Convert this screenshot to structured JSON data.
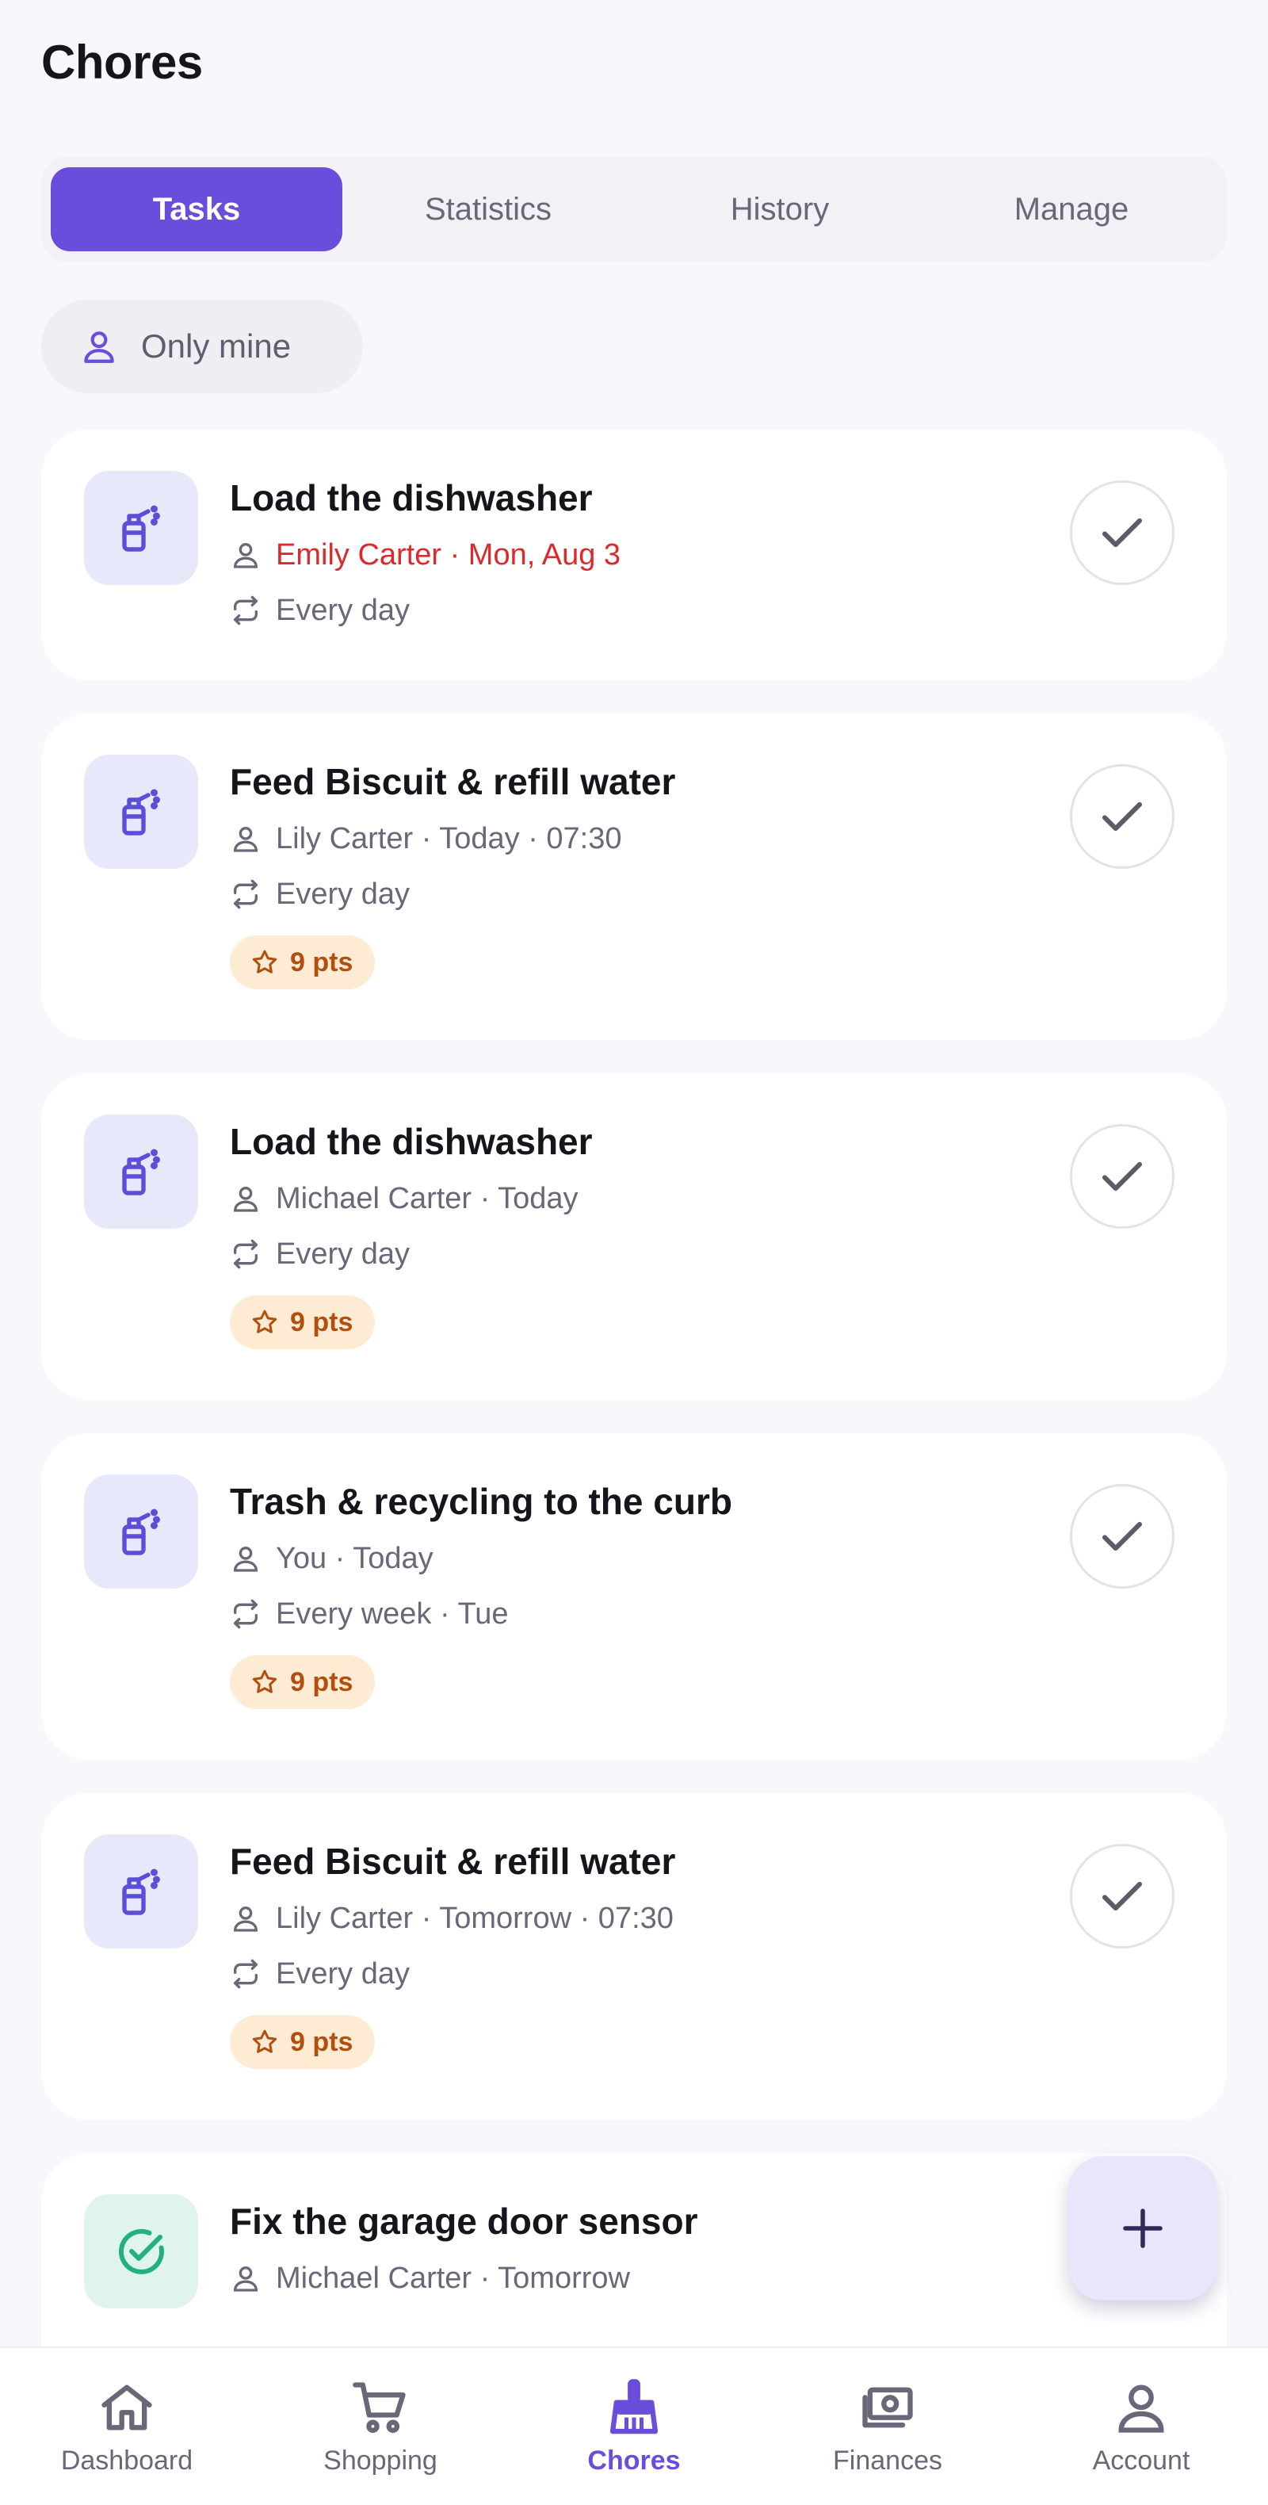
{
  "header": {
    "title": "Chores"
  },
  "tabs": [
    {
      "label": "Tasks",
      "active": true
    },
    {
      "label": "Statistics",
      "active": false
    },
    {
      "label": "History",
      "active": false
    },
    {
      "label": "Manage",
      "active": false
    }
  ],
  "filter": {
    "label": "Only mine",
    "icon": "person-icon"
  },
  "tasks": [
    {
      "title": "Load the dishwasher",
      "assignee_line": "Emily Carter · Mon, Aug 3",
      "overdue": true,
      "recurrence": "Every day",
      "points": null,
      "icon": "spray-bottle-icon"
    },
    {
      "title": "Feed Biscuit & refill water",
      "assignee_line": "Lily Carter · Today · 07:30",
      "overdue": false,
      "recurrence": "Every day",
      "points": "9 pts",
      "icon": "spray-bottle-icon"
    },
    {
      "title": "Load the dishwasher",
      "assignee_line": "Michael Carter · Today",
      "overdue": false,
      "recurrence": "Every day",
      "points": "9 pts",
      "icon": "spray-bottle-icon"
    },
    {
      "title": "Trash & recycling to the curb",
      "assignee_line": "You · Today",
      "overdue": false,
      "recurrence": "Every week · Tue",
      "points": "9 pts",
      "icon": "spray-bottle-icon"
    },
    {
      "title": "Feed Biscuit & refill water",
      "assignee_line": "Lily Carter · Tomorrow · 07:30",
      "overdue": false,
      "recurrence": "Every day",
      "points": "9 pts",
      "icon": "spray-bottle-icon"
    },
    {
      "title": "Fix the garage door sensor",
      "assignee_line": "Michael Carter · Tomorrow",
      "overdue": false,
      "recurrence": null,
      "points": null,
      "icon": "check-circle-icon"
    }
  ],
  "fab": {
    "icon": "plus-icon"
  },
  "nav": [
    {
      "label": "Dashboard",
      "icon": "home-icon",
      "active": false
    },
    {
      "label": "Shopping",
      "icon": "cart-icon",
      "active": false
    },
    {
      "label": "Chores",
      "icon": "broom-icon",
      "active": true
    },
    {
      "label": "Finances",
      "icon": "cash-icon",
      "active": false
    },
    {
      "label": "Account",
      "icon": "person-icon",
      "active": false
    }
  ],
  "colors": {
    "accent": "#6b4ddb",
    "overdue": "#d92b2b",
    "points_bg": "#fdebd3",
    "points_text": "#b24f0e",
    "done_green": "#22b07d"
  }
}
